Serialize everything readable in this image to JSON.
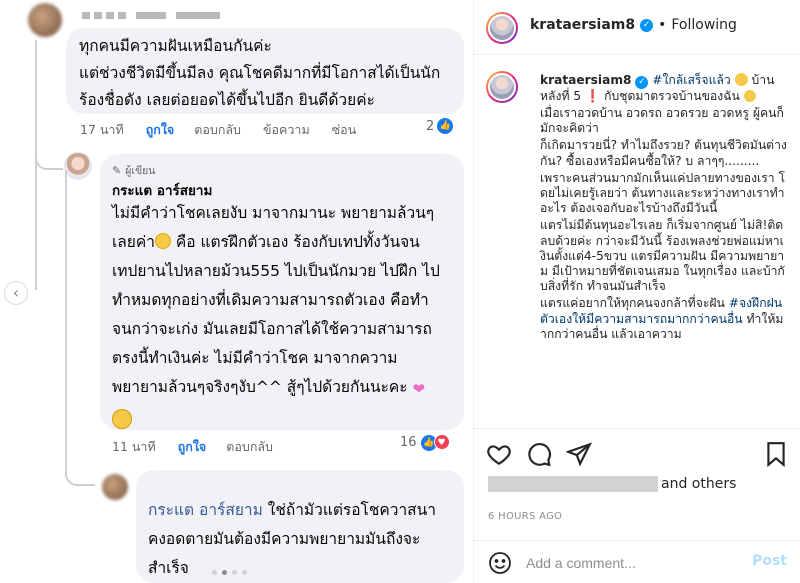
{
  "left": {
    "comment1": {
      "lines": [
        "ทุกคนมีความฝันเหมือนกันค่ะ",
        "แต่ช่วงชีวิตมีขึ้นมีลง คุณโชคดีมากที่มีโอกาสได้เป็นนัก",
        "ร้องชื่อดัง เลยต่อยอดได้ขึ้นไปอีก ยินดีด้วยค่ะ"
      ],
      "time": "17 นาที",
      "like": "ถูกใจ",
      "reply": "ตอบกลับ",
      "message": "ข้อความ",
      "hide": "ซ่อน",
      "reaction_count": "2"
    },
    "reply1": {
      "badge": "ผู้เขียน",
      "author": "กระแต อาร์สยาม",
      "lines": [
        "ไม่มีคำว่าโชคเลยงับ มาจากมานะ พยายามล้วนๆ",
        "เลยค่า",
        " คือ แตรฝึกตัวเอง ร้องกับเทปทั้งวันจน",
        "เทปยานไปหลายม้วน555 ไปเป็นนักมวย ไปฝึก ไป",
        "ทำหมดทุกอย่างที่เดิมความสามารถตัวเอง คือทำ",
        "จนกว่าจะเก่ง มันเลยมีโอกาสได้ใช้ความสามารถ",
        "ตรงนี้ทำเงินค่ะ ไม่มีคำว่าโชค มาจากความ",
        "พยายามล้วนๆจริงๆงับ^^ สู้ๆไปด้วยกันนะคะ"
      ],
      "time": "11 นาที",
      "like": "ถูกใจ",
      "reply": "ตอบกลับ",
      "reaction_count": "16"
    },
    "reply2": {
      "mention": "กระแต อาร์สยาม",
      "line1_rest": " ใช่ถ้ามัวแต่รอโชควาสนา",
      "line2": "คงอดตายมันต้องมีความพยายามมันถึงจะ",
      "line3": "สำเร็จ"
    }
  },
  "right": {
    "header": {
      "username": "krataersiam8",
      "separator": "•",
      "following": "Following"
    },
    "caption": {
      "username": "krataersiam8",
      "hashtag1": "#ใกล้เสร็จแล้ว",
      "text_lines": [
        " บ้าน หลังที่ 5",
        "กับชุดมาตรวจบ้านของฉัน",
        "เมื่อเราอวดบ้าน อวดรถ อวดรวย อวดหรู ผู้คนก็มักจะคิดว่า",
        "ก็เกิดมารวยนี่? ทำไมถึงรวย? ต้นทุนชีวิตมันต่างกัน? ซื้อเองหรือมีคนซื้อให้? บ ลาๆๆ.........",
        "เพราะคนส่วนมากมักเห็นแค่ปลายทางของเรา โดยไม่เคยรู้เลยว่า ต้นทางและระหว่างทางเราทำอะไร ต้องเจอกับอะไรบ้างถึงมีวันนี้",
        "แตรไม่มีต้นทุนอะไรเลย ก็เริ่มจากศูนย์ ไม่สิ!ติดลบด้วยค่ะ กว่าจะมีวันนี้ ร้องเพลงช่วยพ่อแม่หาเงินตั้งแต่4-5ขวบ แตรมีความฝัน มีความพยายาม มีเป้าหมายที่ชัดเจนเสมอ ในทุกเรื่อง และบ้ากับสิ่งที่รัก ทำจนมันสำเร็จ",
        "แตรแค่อยากให้ทุกคนจงกล้าที่จะฝัน"
      ],
      "hashtag2": "#จงฝึกฝนตัวเองให้มีความสามารถมากกว่าคนอื่น",
      "tail": " ทำให้มากกว่าคนอื่น แล้วเอาความ"
    },
    "likes": {
      "and_others": "and others"
    },
    "time_ago": "6 HOURS AGO",
    "comment_box": {
      "placeholder": "Add a comment...",
      "post": "Post"
    }
  }
}
